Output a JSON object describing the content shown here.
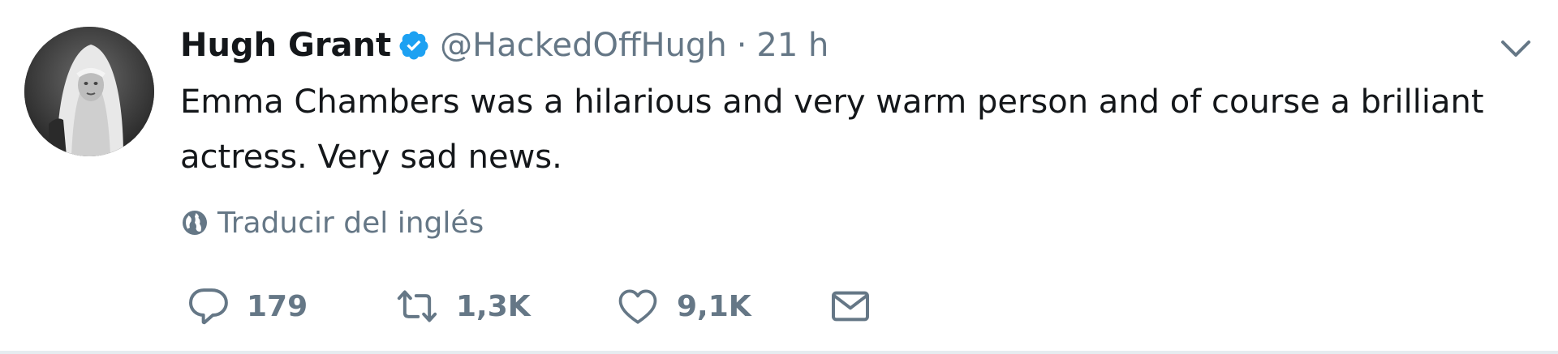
{
  "tweet": {
    "author_name": "Hugh Grant",
    "handle": "@HackedOffHugh",
    "separator": "·",
    "time": "21 h",
    "text": "Emma Chambers was a hilarious and very warm person and of course a brilliant actress. Very sad news.",
    "translate_label": "Traducir del inglés",
    "verified": true
  },
  "actions": {
    "replies": "179",
    "retweets": "1,3K",
    "likes": "9,1K"
  },
  "icons": {
    "verified": "verified-badge-icon",
    "chevron": "chevron-down-icon",
    "globe": "globe-icon",
    "reply": "reply-icon",
    "retweet": "retweet-icon",
    "like": "heart-icon",
    "message": "envelope-icon"
  },
  "colors": {
    "accent": "#1da1f2",
    "text": "#14171a",
    "secondary": "#657786",
    "divider": "#e6ecf0"
  }
}
